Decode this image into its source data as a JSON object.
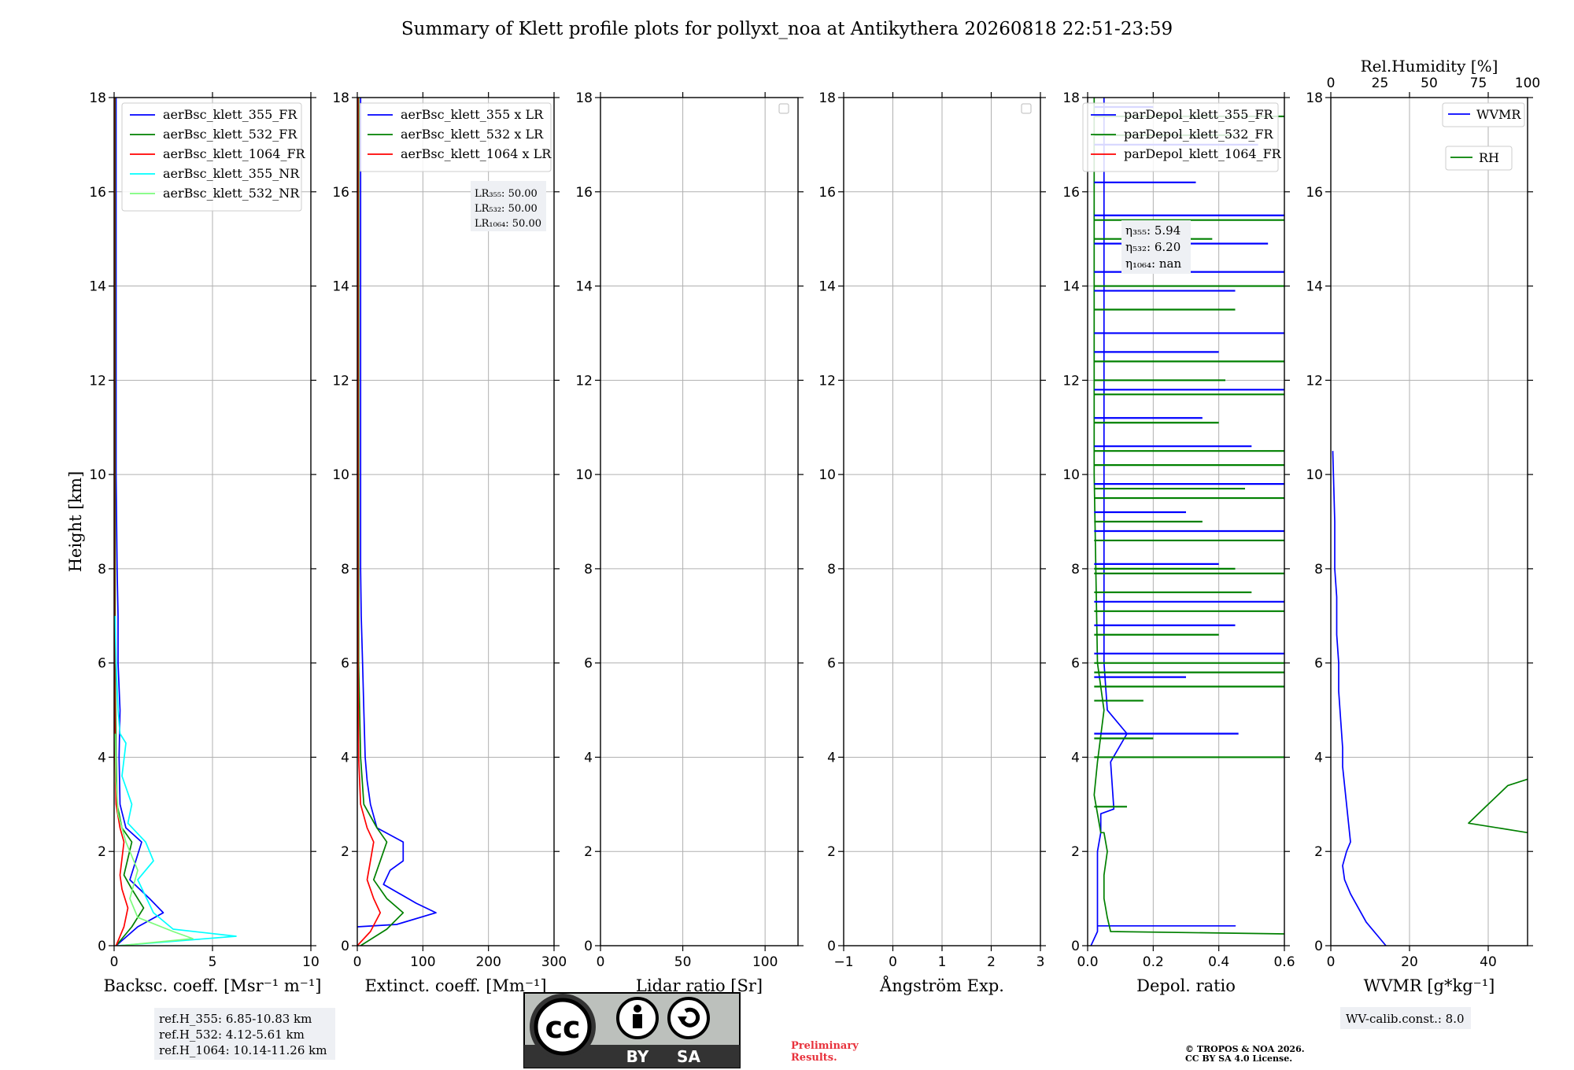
{
  "title": "Summary of Klett profile plots for pollyxt_noa at Antikythera 20260818 22:51-23:59",
  "colors": {
    "b355": "#0000ff",
    "g532": "#008000",
    "r1064": "#ff0000",
    "c355nr": "#00ffff",
    "lg532nr": "#7cfc7c",
    "grid": "#b0b0b0",
    "box_bg": "#eef0f4",
    "prelim": "#e8323c"
  },
  "chart_data": [
    {
      "type": "line",
      "ylabel": "Height [km]",
      "xlabel": "Backsc. coeff. [Msr⁻¹ m⁻¹]",
      "xlim": [
        0,
        10
      ],
      "ylim": [
        0,
        18
      ],
      "xticks": [
        "0",
        "5",
        "10"
      ],
      "yticks": [
        "0",
        "2",
        "4",
        "6",
        "8",
        "10",
        "12",
        "14",
        "16",
        "18"
      ],
      "legend_position": "top-right",
      "series": [
        {
          "name": "aerBsc_klett_355_FR",
          "color": "#0000ff",
          "x": [
            0.1,
            1.2,
            2.5,
            1.8,
            0.8,
            1.4,
            0.6,
            0.3,
            0.25,
            0.3,
            0.2,
            0.2,
            0.15,
            0.1,
            0.1,
            0.1,
            0.1,
            0.1
          ],
          "y": [
            0.0,
            0.4,
            0.7,
            1.0,
            1.4,
            2.2,
            2.5,
            3.0,
            4.0,
            5.0,
            6.0,
            7.0,
            8.0,
            10.0,
            12.0,
            14.0,
            16.0,
            18.0
          ]
        },
        {
          "name": "aerBsc_klett_532_FR",
          "color": "#008000",
          "x": [
            0.1,
            0.9,
            1.5,
            0.9,
            0.5,
            0.9,
            0.4,
            0.15,
            0.1,
            0.05,
            0.05,
            0.05,
            0.05
          ],
          "y": [
            0.0,
            0.4,
            0.8,
            1.2,
            1.5,
            2.2,
            2.5,
            3.0,
            4.0,
            6.0,
            10.0,
            14.0,
            18.0
          ]
        },
        {
          "name": "aerBsc_klett_1064_FR",
          "color": "#ff0000",
          "x": [
            0.1,
            0.5,
            0.7,
            0.4,
            0.3,
            0.5,
            0.3,
            0.1,
            0.05,
            0.02,
            0.02,
            0.02
          ],
          "y": [
            0.0,
            0.4,
            0.8,
            1.2,
            1.5,
            2.2,
            2.5,
            3.0,
            4.0,
            6.0,
            12.0,
            18.0
          ]
        },
        {
          "name": "aerBsc_klett_355_NR",
          "color": "#00ffff",
          "x": [
            0.2,
            6.2,
            3.0,
            2.0,
            1.2,
            2.0,
            1.6,
            0.7,
            0.9,
            0.4,
            0.6,
            0.3,
            0.2,
            0.1,
            0.05
          ],
          "y": [
            0.0,
            0.2,
            0.35,
            0.7,
            1.4,
            1.8,
            2.2,
            2.6,
            3.0,
            3.6,
            4.3,
            4.5,
            5.0,
            6.0,
            7.0
          ]
        },
        {
          "name": "aerBsc_klett_532_NR",
          "color": "#7cfc7c",
          "x": [
            0.3,
            4.0,
            3.0,
            1.2,
            0.8,
            1.2,
            0.6,
            0.2,
            0.1,
            0.05
          ],
          "y": [
            0.0,
            0.15,
            0.3,
            0.6,
            1.0,
            1.6,
            2.2,
            2.8,
            3.5,
            4.5
          ]
        }
      ],
      "annotation": "",
      "box_lines": [
        "ref.H_355: 6.85-10.83 km",
        "ref.H_532: 4.12-5.61 km",
        "ref.H_1064: 10.14-11.26 km"
      ]
    },
    {
      "type": "line",
      "xlabel": "Extinct. coeff. [Mm⁻¹]",
      "xlim": [
        0,
        300
      ],
      "ylim": [
        0,
        18
      ],
      "xticks": [
        "0",
        "100",
        "200",
        "300"
      ],
      "yticks": [
        "0",
        "2",
        "4",
        "6",
        "8",
        "10",
        "12",
        "14",
        "16",
        "18"
      ],
      "legend_position": "top-right",
      "series": [
        {
          "name": "aerBsc_klett_355 x LR",
          "color": "#0000ff",
          "x": [
            0,
            60,
            120,
            90,
            40,
            50,
            70,
            70,
            70,
            30,
            20,
            15,
            12,
            10,
            8,
            6,
            5,
            5,
            5,
            5,
            5,
            5,
            5
          ],
          "y": [
            0.4,
            0.45,
            0.7,
            0.9,
            1.3,
            1.6,
            1.8,
            2.0,
            2.2,
            2.5,
            3.0,
            3.5,
            4.0,
            5.0,
            6.0,
            7.0,
            8.0,
            10.0,
            12.0,
            13.6,
            14.0,
            16.0,
            18.0
          ]
        },
        {
          "name": "aerBsc_klett_532 x LR",
          "color": "#008000",
          "x": [
            5,
            45,
            70,
            45,
            25,
            35,
            45,
            30,
            10,
            5,
            2,
            2,
            2
          ],
          "y": [
            0.0,
            0.35,
            0.7,
            1.0,
            1.4,
            1.8,
            2.2,
            2.5,
            3.0,
            4.0,
            6.0,
            12.0,
            18.0
          ]
        },
        {
          "name": "aerBsc_klett_1064 x LR",
          "color": "#ff0000",
          "x": [
            0,
            20,
            35,
            25,
            15,
            20,
            25,
            15,
            5,
            2,
            1,
            1
          ],
          "y": [
            0.0,
            0.3,
            0.7,
            1.0,
            1.4,
            1.8,
            2.2,
            2.5,
            3.0,
            4.0,
            6.0,
            18.0
          ]
        }
      ],
      "lr_lines": [
        "LR₃₅₅: 50.00",
        "LR₅₃₂: 50.00",
        "LR₁₀₆₄: 50.00"
      ]
    },
    {
      "type": "line",
      "xlabel": "Lidar ratio [Sr]",
      "xlim": [
        0,
        120
      ],
      "ylim": [
        0,
        18
      ],
      "xticks": [
        "0",
        "50",
        "100"
      ],
      "yticks": [
        "0",
        "2",
        "4",
        "6",
        "8",
        "10",
        "12",
        "14",
        "16",
        "18"
      ],
      "series": []
    },
    {
      "type": "line",
      "xlabel": "Ångström Exp.",
      "xlim": [
        -1,
        3
      ],
      "ylim": [
        0,
        18
      ],
      "xticks": [
        "−1",
        "0",
        "1",
        "2",
        "3"
      ],
      "yticks": [
        "0",
        "2",
        "4",
        "6",
        "8",
        "10",
        "12",
        "14",
        "16",
        "18"
      ],
      "series": []
    },
    {
      "type": "line",
      "xlabel": "Depol. ratio",
      "xlim": [
        0,
        0.6
      ],
      "ylim": [
        0,
        18
      ],
      "xticks": [
        "0.0",
        "0.2",
        "0.4",
        "0.6"
      ],
      "yticks": [
        "0",
        "2",
        "4",
        "6",
        "8",
        "10",
        "12",
        "14",
        "16",
        "18"
      ],
      "legend_position": "top-right",
      "series": [
        {
          "name": "parDepol_klett_355_FR",
          "color": "#0000ff",
          "x": [
            0.01,
            0.03,
            0.03,
            0.45,
            0.03,
            0.03,
            0.03,
            0.04,
            0.04,
            0.08,
            0.07,
            0.12,
            0.06,
            0.05,
            0.05,
            0.05
          ],
          "y": [
            0.0,
            0.3,
            0.42,
            0.42,
            0.42,
            1.0,
            2.0,
            2.4,
            2.8,
            2.9,
            3.9,
            4.5,
            5.0,
            6.0,
            10.0,
            18.0
          ]
        },
        {
          "name": "parDepol_klett_532_FR",
          "color": "#008000",
          "x": [
            0.6,
            0.07,
            0.06,
            0.05,
            0.05,
            0.06,
            0.05,
            0.04,
            0.03,
            0.02,
            0.03,
            0.05,
            0.03,
            0.02,
            0.02
          ],
          "y": [
            0.25,
            0.3,
            0.6,
            1.0,
            1.5,
            2.0,
            2.4,
            2.4,
            2.8,
            3.2,
            3.9,
            5.0,
            6.0,
            10.0,
            18.0
          ]
        }
      ],
      "spikes_355": [
        [
          0.2,
          17.8
        ],
        [
          0.52,
          17.0
        ],
        [
          0.33,
          16.2
        ],
        [
          0.6,
          15.5
        ],
        [
          0.55,
          14.9
        ],
        [
          0.6,
          14.3
        ],
        [
          0.45,
          13.9
        ],
        [
          0.6,
          13.0
        ],
        [
          0.4,
          12.6
        ],
        [
          0.6,
          11.8
        ],
        [
          0.35,
          11.2
        ],
        [
          0.5,
          10.6
        ],
        [
          0.6,
          9.8
        ],
        [
          0.3,
          9.2
        ],
        [
          0.6,
          8.8
        ],
        [
          0.4,
          8.1
        ],
        [
          0.6,
          7.3
        ],
        [
          0.45,
          6.8
        ],
        [
          0.6,
          6.2
        ],
        [
          0.3,
          5.7
        ],
        [
          0.46,
          4.5
        ]
      ],
      "spikes_532": [
        [
          0.6,
          17.6
        ],
        [
          0.45,
          17.2
        ],
        [
          0.6,
          15.4
        ],
        [
          0.38,
          15.0
        ],
        [
          0.6,
          14.0
        ],
        [
          0.45,
          13.5
        ],
        [
          0.6,
          12.4
        ],
        [
          0.42,
          12.0
        ],
        [
          0.6,
          11.7
        ],
        [
          0.4,
          11.1
        ],
        [
          0.6,
          10.5
        ],
        [
          0.6,
          10.2
        ],
        [
          0.48,
          9.7
        ],
        [
          0.6,
          9.5
        ],
        [
          0.35,
          9.0
        ],
        [
          0.6,
          8.6
        ],
        [
          0.45,
          8.0
        ],
        [
          0.6,
          7.9
        ],
        [
          0.5,
          7.5
        ],
        [
          0.6,
          7.1
        ],
        [
          0.4,
          6.6
        ],
        [
          0.6,
          6.0
        ],
        [
          0.6,
          5.8
        ],
        [
          0.6,
          5.5
        ],
        [
          0.17,
          5.2
        ],
        [
          0.2,
          4.4
        ],
        [
          0.6,
          4.0
        ],
        [
          0.12,
          2.95
        ]
      ],
      "eta_lines": [
        "η₃₅₅: 5.94",
        "η₅₃₂: 6.20",
        "η₁₀₆₄: nan"
      ],
      "legend_entries": [
        "parDepol_klett_355_FR",
        "parDepol_klett_532_FR",
        "parDepol_klett_1064_FR"
      ]
    },
    {
      "type": "line",
      "xlabel": "WVMR [g*kg⁻¹]",
      "xlim": [
        0,
        50
      ],
      "ylim": [
        0,
        18
      ],
      "xticks": [
        "0",
        "20",
        "40"
      ],
      "yticks": [
        "0",
        "2",
        "4",
        "6",
        "8",
        "10",
        "12",
        "14",
        "16",
        "18"
      ],
      "top_axis": {
        "label": "Rel.Humidity [%]",
        "xlim": [
          0,
          100
        ],
        "xticks": [
          "0",
          "25",
          "50",
          "75",
          "100"
        ]
      },
      "series": [
        {
          "name": "WVMR",
          "color": "#0000ff",
          "x": [
            14,
            12,
            9,
            7,
            5,
            3.5,
            3,
            4,
            5,
            4.5,
            4,
            3.5,
            3,
            3,
            2.5,
            2,
            2,
            1.5,
            1.5,
            1,
            1,
            0.5
          ],
          "y": [
            0.0,
            0.2,
            0.5,
            0.8,
            1.1,
            1.4,
            1.7,
            2.0,
            2.2,
            2.6,
            3.0,
            3.4,
            3.8,
            4.2,
            4.8,
            5.4,
            6.0,
            6.6,
            7.4,
            8.0,
            9.0,
            10.5
          ]
        },
        {
          "name": "RH",
          "color": "#008000",
          "x": [
            98,
            92,
            90,
            86,
            80,
            70,
            68,
            75,
            82,
            90,
            98,
            98,
            100,
            98,
            95,
            50,
            35,
            40,
            45,
            60,
            55,
            70,
            75,
            80,
            85,
            90,
            70,
            100
          ],
          "y": [
            0.4,
            0.5,
            0.7,
            0.9,
            1.1,
            1.3,
            1.4,
            1.5,
            1.6,
            1.7,
            1.8,
            2.0,
            2.2,
            2.3,
            2.35,
            2.4,
            2.6,
            3.0,
            3.4,
            3.8,
            4.2,
            4.6,
            5.0,
            5.4,
            5.6,
            6.0,
            6.4,
            7.5
          ]
        }
      ],
      "legend_entries": [
        "WVMR",
        "RH"
      ],
      "calib_text": "WV-calib.const.: 8.0"
    }
  ],
  "footer": {
    "cc_label_by": "BY",
    "cc_label_sa": "SA",
    "prelim_line1": "Preliminary",
    "prelim_line2": "Results.",
    "copyright_line1": "© TROPOS & NOA 2026.",
    "copyright_line2": "CC BY SA 4.0 License."
  }
}
